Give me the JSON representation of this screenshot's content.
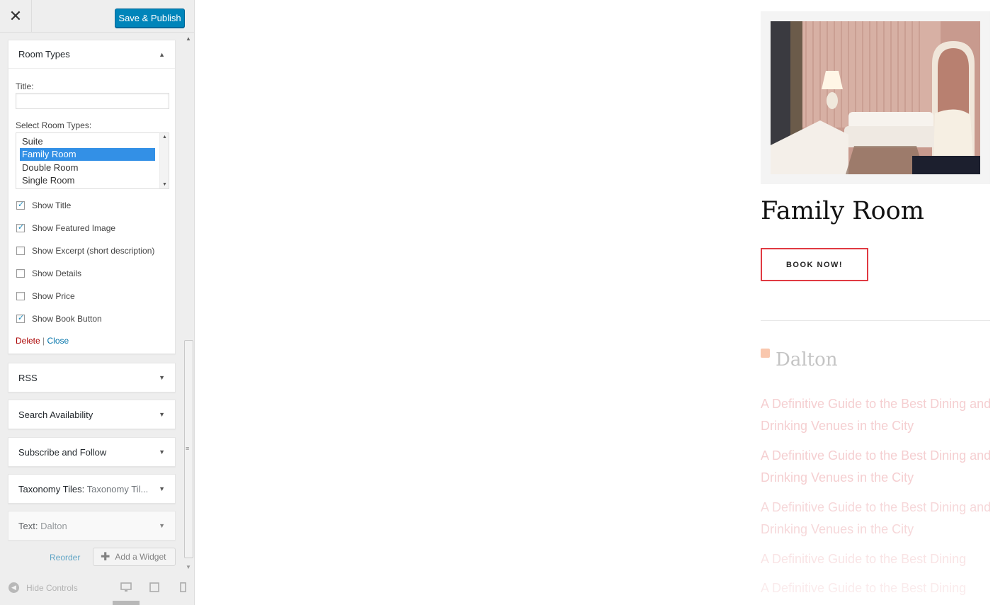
{
  "header": {
    "close_glyph": "✕",
    "publish_label": "Save & Publish"
  },
  "room_types_widget": {
    "title": "Room Types",
    "title_label": "Title:",
    "title_value": "",
    "select_label": "Select Room Types:",
    "options": [
      "Suite",
      "Family Room",
      "Double Room",
      "Single Room"
    ],
    "selected": "Family Room",
    "checkboxes": [
      {
        "label": "Show Title",
        "checked": true
      },
      {
        "label": "Show Featured Image",
        "checked": true
      },
      {
        "label": "Show Excerpt (short description)",
        "checked": false
      },
      {
        "label": "Show Details",
        "checked": false
      },
      {
        "label": "Show Price",
        "checked": false
      },
      {
        "label": "Show Book Button",
        "checked": true
      }
    ],
    "delete_label": "Delete",
    "separator": "|",
    "close_label": "Close"
  },
  "widgets": [
    {
      "title": "RSS",
      "sub": ""
    },
    {
      "title": "Search Availability",
      "sub": ""
    },
    {
      "title": "Subscribe and Follow",
      "sub": ""
    },
    {
      "title": "Taxonomy Tiles:",
      "sub": "Taxonomy Til..."
    },
    {
      "title": "Text:",
      "sub": "Dalton"
    }
  ],
  "bottom": {
    "reorder_label": "Reorder",
    "add_widget_label": "Add a Widget"
  },
  "footer": {
    "hide_controls_label": "Hide Controls",
    "devices": [
      "desktop-icon",
      "tablet-icon",
      "mobile-icon"
    ]
  },
  "preview": {
    "room_title": "Family Room",
    "book_label": "BOOK NOW!",
    "rss_heading": "Dalton",
    "posts": [
      "A Definitive Guide to the Best Dining and Drinking Venues in the City",
      "A Definitive Guide to the Best Dining and Drinking Venues in the City",
      "A Definitive Guide to the Best Dining and Drinking Venues in the City",
      "A Definitive Guide to the Best Dining",
      "A Definitive Guide to the Best Dining"
    ]
  },
  "colors": {
    "primary_button": "#0085ba",
    "book_border": "#e03a42",
    "selected_option": "#3390e6"
  }
}
